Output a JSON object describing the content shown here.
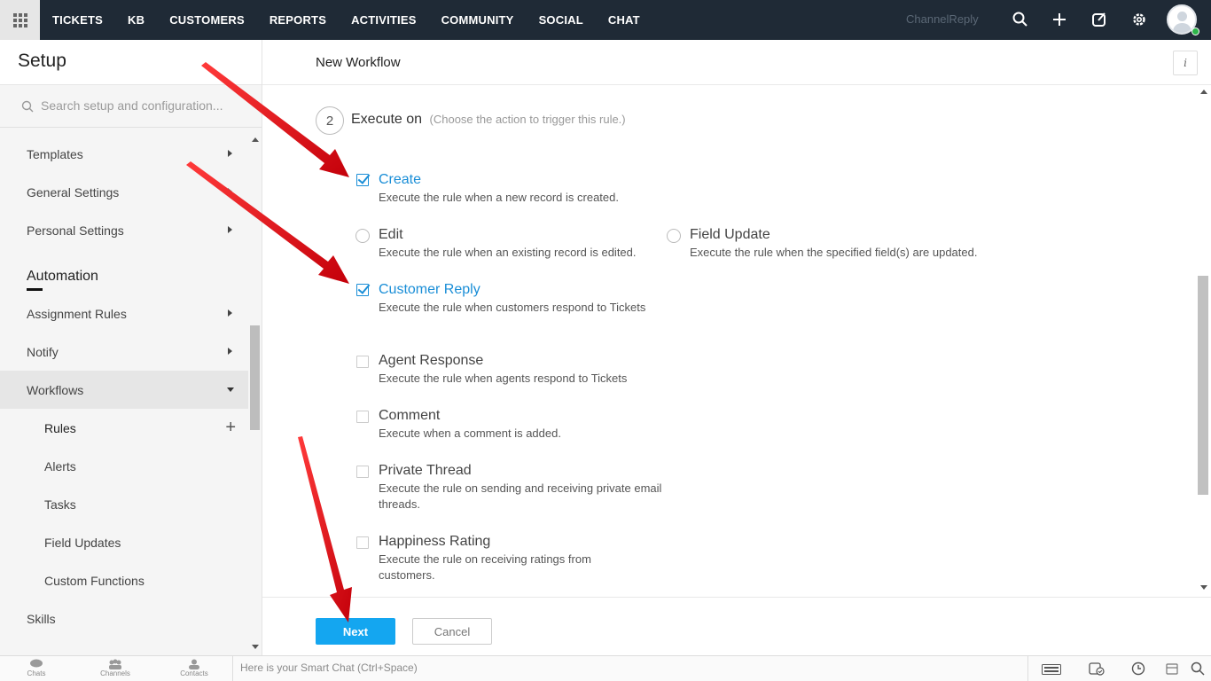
{
  "topbar": {
    "nav": [
      "TICKETS",
      "KB",
      "CUSTOMERS",
      "REPORTS",
      "ACTIVITIES",
      "COMMUNITY",
      "SOCIAL",
      "CHAT"
    ],
    "brand": "ChannelReply",
    "icons": [
      "search-icon",
      "plus-icon",
      "compose-icon",
      "gear-icon",
      "avatar"
    ],
    "status_color": "#2db54a"
  },
  "sidebar": {
    "title": "Setup",
    "search_placeholder": "Search setup and configuration...",
    "items": [
      {
        "label": "Templates"
      },
      {
        "label": "General Settings"
      },
      {
        "label": "Personal Settings"
      }
    ],
    "section": "Automation",
    "automation_items": [
      {
        "label": "Assignment Rules"
      },
      {
        "label": "Notify"
      },
      {
        "label": "Workflows"
      }
    ],
    "workflow_children": [
      {
        "label": "Rules"
      },
      {
        "label": "Alerts"
      },
      {
        "label": "Tasks"
      },
      {
        "label": "Field Updates"
      },
      {
        "label": "Custom Functions"
      }
    ],
    "after": [
      {
        "label": "Skills"
      }
    ]
  },
  "main": {
    "title": "New Workflow",
    "info_icon": "i",
    "step_number": "2",
    "step_title": "Execute on",
    "step_hint": "(Choose the action to trigger this rule.)",
    "options": [
      {
        "label": "Create",
        "desc": "Execute the rule when a new record is created.",
        "control": "checkbox",
        "checked": true
      },
      {
        "label": "Edit",
        "desc": "Execute the rule when an existing record is edited.",
        "control": "radio",
        "checked": false
      },
      {
        "label": "Field Update",
        "desc": "Execute the rule when the specified field(s) are updated.",
        "control": "radio",
        "checked": false
      },
      {
        "label": "Customer Reply",
        "desc": "Execute the rule when customers respond to Tickets",
        "control": "checkbox",
        "checked": true
      },
      {
        "label": "Agent Response",
        "desc": "Execute the rule when agents respond to Tickets",
        "control": "checkbox",
        "checked": false
      },
      {
        "label": "Comment",
        "desc": "Execute when a comment is added.",
        "control": "checkbox",
        "checked": false
      },
      {
        "label": "Private Thread",
        "desc": "Execute the rule on sending and receiving private email threads.",
        "control": "checkbox",
        "checked": false
      },
      {
        "label": "Happiness Rating",
        "desc": "Execute the rule on receiving ratings from customers.",
        "control": "checkbox",
        "checked": false
      }
    ],
    "next_label": "Next",
    "cancel_label": "Cancel",
    "accent": "#14a6f0",
    "check_color": "#1a8ed7"
  },
  "bottombar": {
    "items": [
      {
        "label": "Chats"
      },
      {
        "label": "Channels"
      },
      {
        "label": "Contacts"
      }
    ],
    "smartchat_placeholder": "Here is your Smart Chat (Ctrl+Space)"
  },
  "annotation_color": "#e3101a"
}
